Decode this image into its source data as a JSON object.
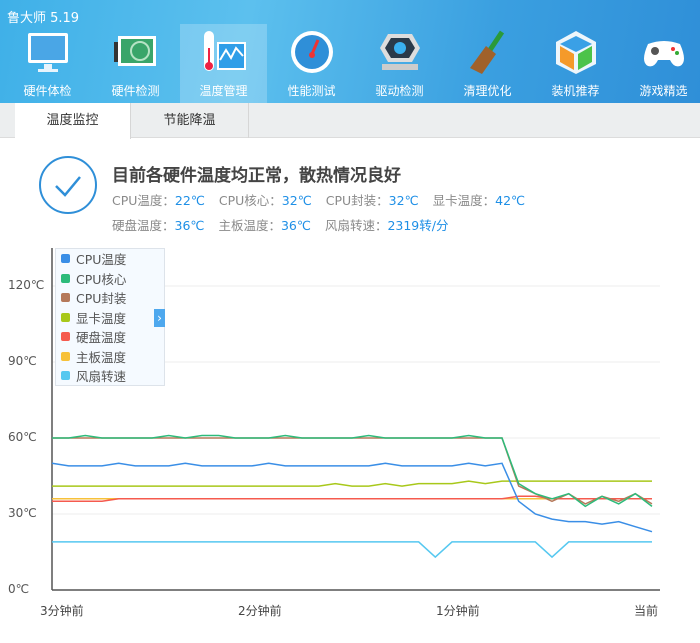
{
  "app_title": "鲁大师 5.19",
  "nav": [
    {
      "label": "硬件体检",
      "icon": "monitor-icon"
    },
    {
      "label": "硬件检测",
      "icon": "graphics-card-icon"
    },
    {
      "label": "温度管理",
      "icon": "thermometer-chart-icon",
      "active": true
    },
    {
      "label": "性能测试",
      "icon": "speedometer-icon"
    },
    {
      "label": "驱动检测",
      "icon": "driver-gear-icon"
    },
    {
      "label": "清理优化",
      "icon": "broom-icon"
    },
    {
      "label": "装机推荐",
      "icon": "cube-icon"
    },
    {
      "label": "游戏精选",
      "icon": "gamepad-icon"
    }
  ],
  "tabs": [
    {
      "label": "温度监控",
      "active": true
    },
    {
      "label": "节能降温"
    }
  ],
  "status": {
    "title": "目前各硬件温度均正常，散热情况良好",
    "row1": [
      {
        "k": "CPU温度：",
        "v": "22℃"
      },
      {
        "k": "CPU核心：",
        "v": "32℃"
      },
      {
        "k": "CPU封装：",
        "v": "32℃"
      },
      {
        "k": "显卡温度：",
        "v": "42℃"
      }
    ],
    "row2": [
      {
        "k": "硬盘温度：",
        "v": "36℃"
      },
      {
        "k": "主板温度：",
        "v": "36℃"
      },
      {
        "k": "风扇转速：",
        "v": "2319转/分"
      }
    ]
  },
  "legend_toggle": "›",
  "colors": {
    "accent": "#1e8fe6"
  },
  "chart_data": {
    "type": "line",
    "xlabel": "",
    "ylabel": "",
    "ylim": [
      0,
      120
    ],
    "yticks": [
      "0℃",
      "30℃",
      "60℃",
      "90℃",
      "120℃"
    ],
    "ytick_values": [
      0,
      30,
      60,
      90,
      120
    ],
    "xticks": [
      "3分钟前",
      "2分钟前",
      "1分钟前",
      "当前"
    ],
    "x_seconds": [
      -180,
      -175,
      -170,
      -165,
      -160,
      -155,
      -150,
      -145,
      -140,
      -135,
      -130,
      -125,
      -120,
      -115,
      -110,
      -105,
      -100,
      -95,
      -90,
      -85,
      -80,
      -75,
      -70,
      -65,
      -60,
      -55,
      -50,
      -45,
      -40,
      -35,
      -30,
      -25,
      -20,
      -15,
      -10,
      -5,
      0
    ],
    "legend_position": "top-left",
    "series": [
      {
        "name": "CPU温度",
        "color": "#3a8ee6",
        "values": [
          50,
          49,
          49,
          49,
          50,
          49,
          49,
          49,
          50,
          49,
          49,
          49,
          49,
          50,
          49,
          49,
          49,
          49,
          49,
          49,
          50,
          49,
          49,
          49,
          49,
          50,
          49,
          50,
          35,
          30,
          28,
          27,
          27,
          26,
          27,
          25,
          23
        ]
      },
      {
        "name": "CPU核心",
        "color": "#2dbb7a",
        "values": [
          60,
          60,
          61,
          60,
          60,
          60,
          60,
          61,
          60,
          61,
          61,
          60,
          60,
          60,
          61,
          60,
          60,
          60,
          60,
          61,
          60,
          60,
          60,
          60,
          60,
          61,
          60,
          60,
          42,
          38,
          36,
          38,
          33,
          37,
          34,
          38,
          33
        ]
      },
      {
        "name": "CPU封装",
        "color": "#b5795a",
        "values": [
          60,
          60,
          60,
          60,
          60,
          60,
          60,
          60,
          60,
          60,
          60,
          60,
          60,
          60,
          60,
          60,
          60,
          60,
          60,
          60,
          60,
          60,
          60,
          60,
          60,
          60,
          60,
          60,
          41,
          38,
          35,
          38,
          34,
          37,
          35,
          38,
          34
        ]
      },
      {
        "name": "显卡温度",
        "color": "#a8c81a",
        "values": [
          41,
          41,
          41,
          41,
          41,
          41,
          41,
          41,
          41,
          41,
          41,
          41,
          41,
          41,
          41,
          41,
          41,
          42,
          41,
          41,
          42,
          41,
          42,
          42,
          42,
          43,
          42,
          43,
          43,
          43,
          43,
          43,
          43,
          43,
          43,
          43,
          43
        ]
      },
      {
        "name": "硬盘温度",
        "color": "#f55a4e",
        "values": [
          35,
          35,
          35,
          35,
          36,
          36,
          36,
          36,
          36,
          36,
          36,
          36,
          36,
          36,
          36,
          36,
          36,
          36,
          36,
          36,
          36,
          36,
          36,
          36,
          36,
          36,
          36,
          36,
          37,
          37,
          36,
          36,
          36,
          36,
          36,
          36,
          36
        ]
      },
      {
        "name": "主板温度",
        "color": "#f7c13a",
        "values": [
          36,
          36,
          36,
          36,
          36,
          36,
          36,
          36,
          36,
          36,
          36,
          36,
          36,
          36,
          36,
          36,
          36,
          36,
          36,
          36,
          36,
          36,
          36,
          36,
          36,
          36,
          36,
          36,
          36,
          36,
          36,
          36,
          36,
          36,
          36,
          36,
          36
        ]
      },
      {
        "name": "风扇转速",
        "color": "#56c8f0",
        "values": [
          19,
          19,
          19,
          19,
          19,
          19,
          19,
          19,
          19,
          19,
          19,
          19,
          19,
          19,
          19,
          19,
          19,
          19,
          19,
          19,
          19,
          19,
          19,
          13,
          19,
          19,
          19,
          19,
          19,
          19,
          13,
          19,
          19,
          19,
          19,
          19,
          19
        ]
      }
    ]
  }
}
